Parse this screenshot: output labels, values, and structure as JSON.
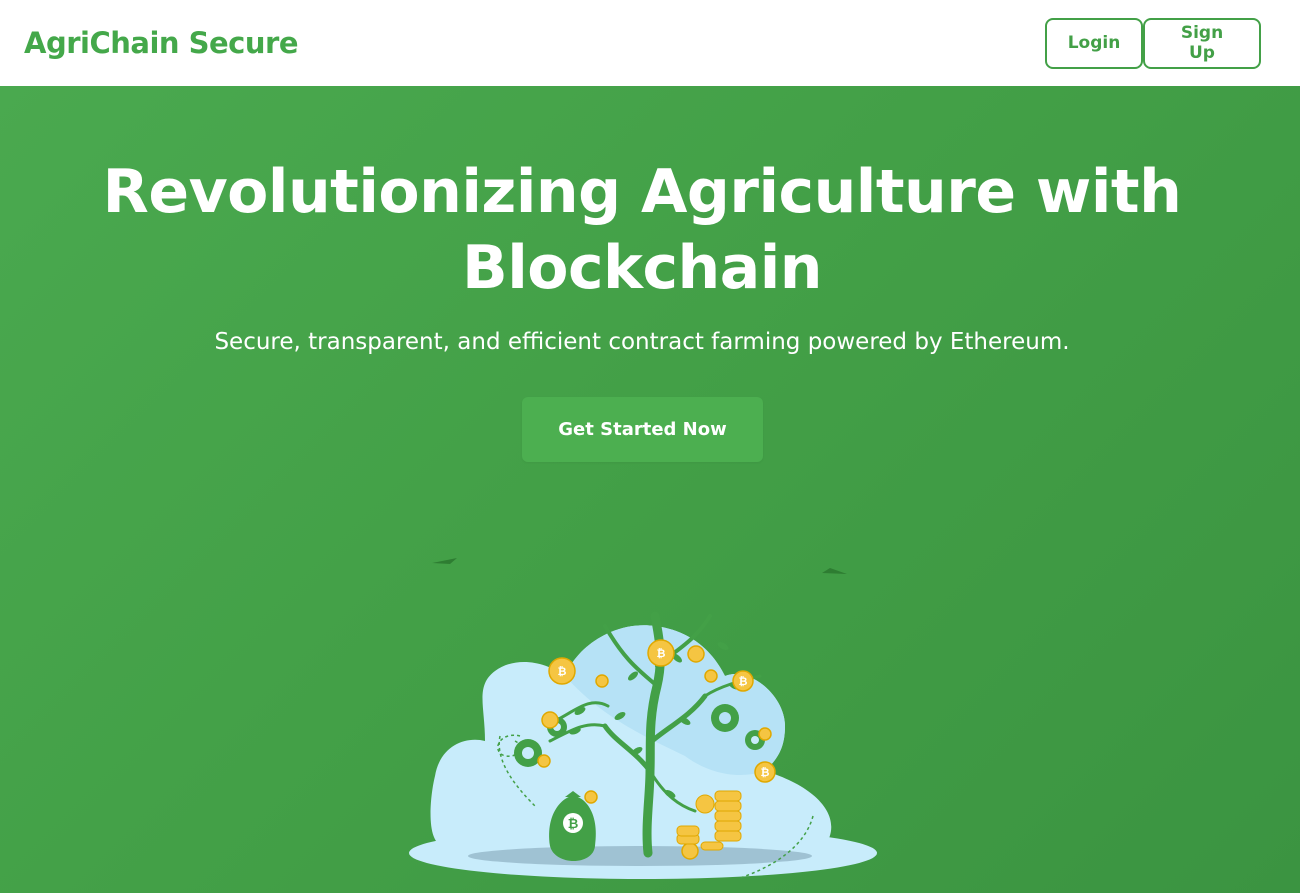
{
  "navbar": {
    "brand": "AgriChain Secure",
    "login_label": "Login",
    "signup_label": "Sign Up"
  },
  "hero": {
    "title": "Revolutionizing Agriculture with Blockchain",
    "subtitle": "Secure, transparent, and efficient contract farming powered by Ethereum.",
    "cta_label": "Get Started Now"
  },
  "illustration": {
    "coin_symbol": "₿"
  },
  "colors": {
    "brand_green": "#44a84a",
    "hero_green": "#43a047",
    "cta_green": "#4caf50",
    "coin_gold": "#f5c542",
    "bush_blue": "#c8ecfb"
  }
}
